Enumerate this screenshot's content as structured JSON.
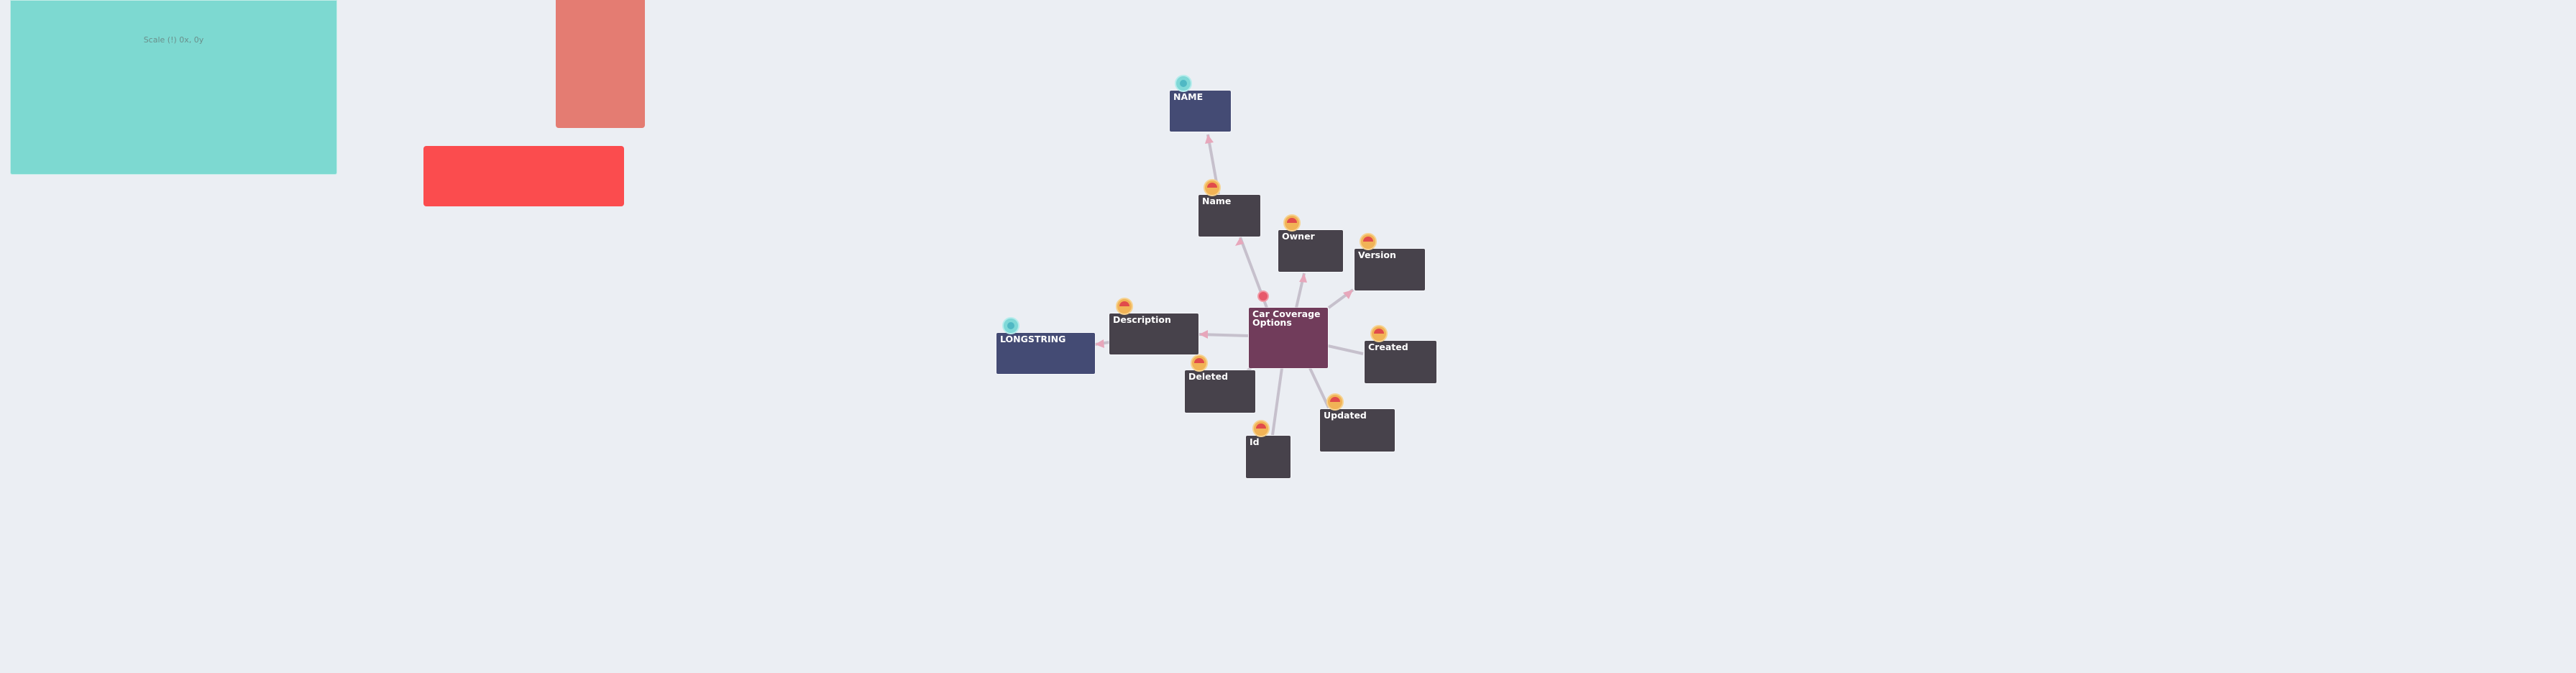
{
  "panels": {
    "teal": {
      "label": "Scale (!) 0x, 0y"
    }
  },
  "colors": {
    "background": "#ebeef3",
    "entity": "#713c5b",
    "field": "#47424b",
    "type": "#444b74",
    "edge": "#c6c0cc"
  },
  "graph": {
    "nodes": {
      "car_coverage_options": "Car Coverage Options",
      "name_type": "NAME",
      "name": "Name",
      "owner": "Owner",
      "version": "Version",
      "created": "Created",
      "updated": "Updated",
      "id": "Id",
      "deleted": "Deleted",
      "description": "Description",
      "longstring": "LONGSTRING"
    }
  }
}
